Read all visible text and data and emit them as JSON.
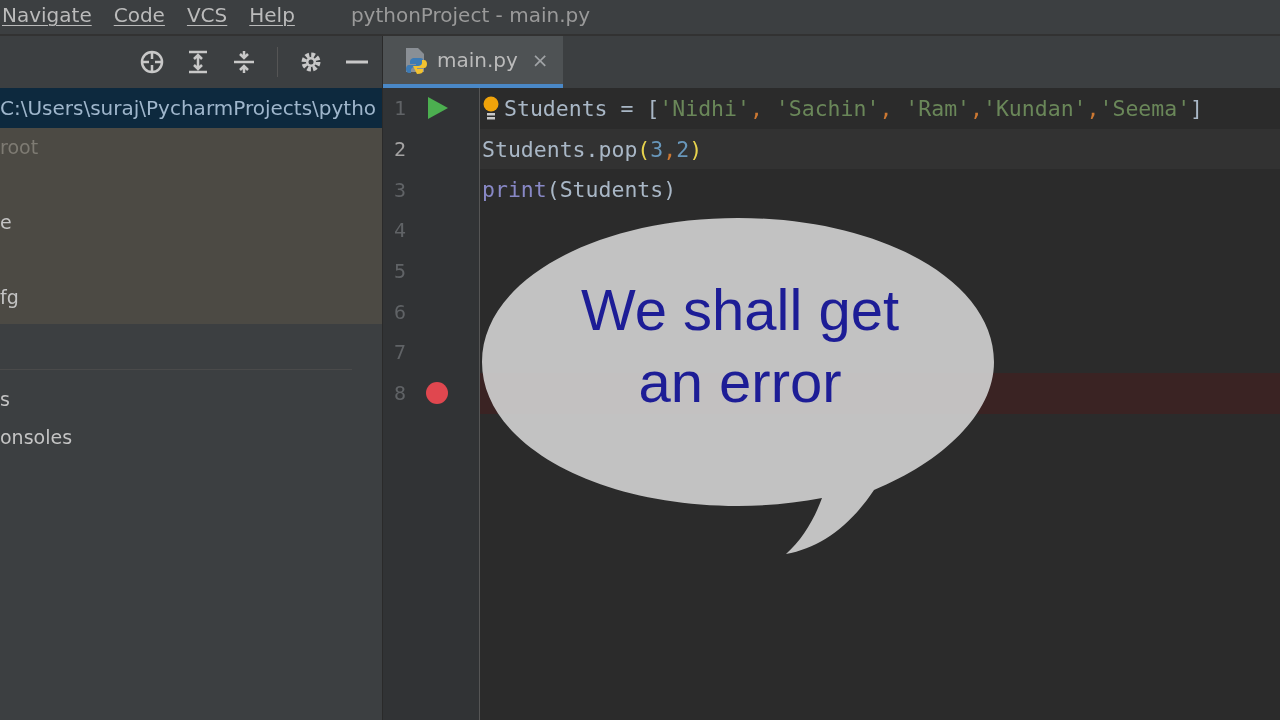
{
  "menu": [
    {
      "label": "Navigate"
    },
    {
      "label": "Code"
    },
    {
      "label": "VCS"
    },
    {
      "label": "Help"
    }
  ],
  "window": {
    "title": "pythonProject - main.py"
  },
  "toolbar": [
    {
      "kind": "locate"
    },
    {
      "kind": "expand"
    },
    {
      "kind": "collapse"
    },
    {
      "kind": "settings"
    },
    {
      "kind": "hide"
    }
  ],
  "tabs": [
    {
      "label": "main.py",
      "selected": true,
      "close": "×"
    }
  ],
  "sidebar": {
    "path": {
      "label": "C:\\Users\\suraj\\PycharmProjects\\pytho",
      "selected": true
    },
    "items": [
      {
        "label": "root",
        "kind": "dim",
        "highlighted": true
      },
      {
        "label": "e",
        "kind": "normal",
        "highlighted": true
      },
      {
        "label": "fg",
        "kind": "normal",
        "highlighted": true
      },
      {
        "label": "s",
        "kind": "normal",
        "highlighted": false
      },
      {
        "label": "onsoles",
        "kind": "normal",
        "highlighted": false
      }
    ]
  },
  "editor": {
    "lines": [
      {
        "number": "1",
        "run": true,
        "breakpoint": false,
        "current": false,
        "bulb": true,
        "tokens": [
          {
            "t": "Students = [",
            "kind": "plain"
          },
          {
            "t": "'Nidhi'",
            "kind": "string"
          },
          {
            "t": ", ",
            "kind": "comma"
          },
          {
            "t": "'Sachin'",
            "kind": "string"
          },
          {
            "t": ", ",
            "kind": "comma"
          },
          {
            "t": "'Ram'",
            "kind": "string"
          },
          {
            "t": ",",
            "kind": "comma"
          },
          {
            "t": "'Kundan'",
            "kind": "string"
          },
          {
            "t": ",",
            "kind": "comma"
          },
          {
            "t": "'Seema'",
            "kind": "string"
          },
          {
            "t": "]",
            "kind": "plain"
          }
        ]
      },
      {
        "number": "2",
        "run": false,
        "breakpoint": false,
        "current": true,
        "bulb": false,
        "tokens": [
          {
            "t": "Students.pop",
            "kind": "plain"
          },
          {
            "t": "(",
            "kind": "paren"
          },
          {
            "t": "3",
            "kind": "number"
          },
          {
            "t": ",",
            "kind": "comma"
          },
          {
            "t": "2",
            "kind": "number"
          },
          {
            "t": ")",
            "kind": "paren"
          }
        ]
      },
      {
        "number": "3",
        "run": false,
        "breakpoint": false,
        "current": false,
        "bulb": false,
        "tokens": [
          {
            "t": "print",
            "kind": "builtin"
          },
          {
            "t": "(Students)",
            "kind": "plain"
          }
        ]
      },
      {
        "number": "4",
        "run": false,
        "breakpoint": false,
        "current": false,
        "bulb": false
      },
      {
        "number": "5",
        "run": false,
        "breakpoint": false,
        "current": false,
        "bulb": false
      },
      {
        "number": "6",
        "run": false,
        "breakpoint": false,
        "current": false,
        "bulb": false
      },
      {
        "number": "7",
        "run": false,
        "breakpoint": false,
        "current": false,
        "bulb": false
      },
      {
        "number": "8",
        "run": false,
        "breakpoint": true,
        "current": false,
        "bulb": false
      }
    ]
  },
  "callout": {
    "lines": [
      "We shall get",
      "an error"
    ]
  }
}
